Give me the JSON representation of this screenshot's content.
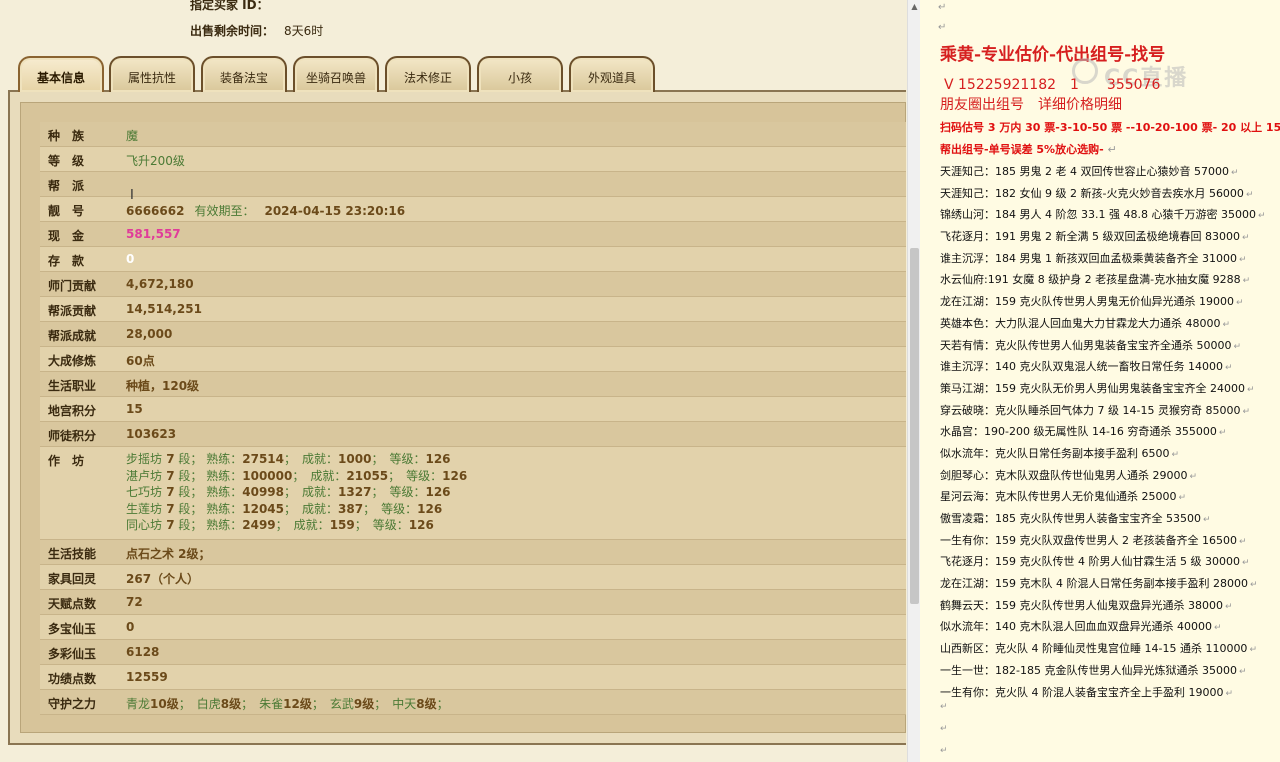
{
  "header": {
    "buyer_label": "指定买家 ID：",
    "time_label": "出售剩余时间：",
    "time_value": "8天6时"
  },
  "tabs": [
    "基本信息",
    "属性抗性",
    "装备法宝",
    "坐骑召唤兽",
    "法术修正",
    "小孩",
    "外观道具"
  ],
  "info": {
    "race": {
      "label": "种　族",
      "value": "魔"
    },
    "level": {
      "label": "等　级",
      "value": "飞升200级"
    },
    "faction": {
      "label": "帮　派",
      "value": ""
    },
    "id": {
      "label": "靓　号",
      "value": "6666662",
      "sub": "有效期至：",
      "expiry": "2024-04-15 23:20:16"
    },
    "cash": {
      "label": "现　金",
      "value": "581,557"
    },
    "deposit": {
      "label": "存　款",
      "value": "0"
    },
    "school_contrib": {
      "label": "师门贡献",
      "value": "4,672,180"
    },
    "faction_contrib": {
      "label": "帮派贡献",
      "value": "14,514,251"
    },
    "faction_achieve": {
      "label": "帮派成就",
      "value": "28,000"
    },
    "practice": {
      "label": "大成修炼",
      "value": "60点"
    },
    "life_job": {
      "label": "生活职业",
      "value": "种植，120级"
    },
    "palace_points": {
      "label": "地宫积分",
      "value": "15"
    },
    "mentor_points": {
      "label": "师徒积分",
      "value": "103623"
    },
    "workshop_label": "作　坊",
    "workshops": [
      {
        "name": "步摇坊",
        "rank": "7",
        "skill": "27514",
        "achieve": "1000",
        "level": "126"
      },
      {
        "name": "湛卢坊",
        "rank": "7",
        "skill": "100000",
        "achieve": "21055",
        "level": "126"
      },
      {
        "name": "七巧坊",
        "rank": "7",
        "skill": "40998",
        "achieve": "1327",
        "level": "126"
      },
      {
        "name": "生莲坊",
        "rank": "7",
        "skill": "12045",
        "achieve": "387",
        "level": "126"
      },
      {
        "name": "同心坊",
        "rank": "7",
        "skill": "2499",
        "achieve": "159",
        "level": "126"
      }
    ],
    "ws_words": {
      "rank_unit": "段；",
      "skill": "熟练：",
      "achieve": "成就：",
      "level": "等级："
    },
    "life_skill": {
      "label": "生活技能",
      "value": "点石之术 2级；"
    },
    "furniture": {
      "label": "家具回灵",
      "value": "267（个人）"
    },
    "talent": {
      "label": "天赋点数",
      "value": "72"
    },
    "duobao": {
      "label": "多宝仙玉",
      "value": "0"
    },
    "duocai": {
      "label": "多彩仙玉",
      "value": "6128"
    },
    "merit": {
      "label": "功绩点数",
      "value": "12559"
    },
    "guardian": {
      "label": "守护之力",
      "items": [
        {
          "name": "青龙",
          "lv": "10级"
        },
        {
          "name": "白虎",
          "lv": "8级"
        },
        {
          "name": "朱雀",
          "lv": "12级"
        },
        {
          "name": "玄武",
          "lv": "9级"
        },
        {
          "name": "中天",
          "lv": "8级"
        }
      ]
    }
  },
  "doc": {
    "title": "乘黄-专业估价-代出组号-找号",
    "phone": "V 15225921182　1　　355076",
    "moments": "朋友圈出组号　详细价格明细",
    "pricing": "扫码估号 3 万内 30 票-3-10-50 票 --10-20-100 票- 20 以上 150",
    "pricing2": "帮出组号-单号误差 5%放心选购-",
    "listings": [
      "天涯知己：185 男鬼 2 老 4 双回传世容止心猿妙音 57000",
      "天涯知己：182 女仙 9 级 2 新孩-火克火妙音去疾水月 56000",
      "锦绣山河：184 男人 4 阶忽 33.1 强 48.8 心猿千万游密 35000",
      "飞花逐月：191 男鬼 2 新全满 5 级双回孟极绝境春回 83000",
      "谁主沉浮：184 男鬼 1 新孩双回血孟极乘黄装备齐全 31000",
      "水云仙府:191 女魔 8 级护身 2 老孩星盘满-克水抽女魔 9288",
      "龙在江湖：159 克火队传世男人男鬼无价仙异光通杀 19000",
      "英雄本色：大力队混人回血鬼大力甘霖龙大力通杀 48000",
      "天若有情：克火队传世男人仙男鬼装备宝宝齐全通杀 50000",
      "谁主沉浮：140 克火队双鬼混人统一畜牧日常任务 14000",
      "策马江湖：159 克火队无价男人男仙男鬼装备宝宝齐全 24000",
      "穿云破晓：克火队睡杀回气体力 7 级 14-15 灵猴穷奇 85000",
      "水晶宫：190-200 级无属性队 14-16 穷奇通杀 355000",
      "似水流年：克火队日常任务副本接手盈利 6500",
      "剑胆琴心：克木队双盘队传世仙鬼男人通杀 29000",
      "星河云海：克木队传世男人无价鬼仙通杀 25000",
      "傲雪凌霜：185 克火队传世男人装备宝宝齐全 53500",
      "一生有你：159 克火队双盘传世男人 2 老孩装备齐全 16500",
      "飞花逐月：159 克火队传世 4 阶男人仙甘霖生活 5 级 30000",
      "龙在江湖：159 克木队 4 阶混人日常任务副本接手盈利 28000",
      "鹤舞云天：159 克火队传世男人仙鬼双盘异光通杀 38000",
      "似水流年：140 克木队混人回血血双盘异光通杀 40000",
      "山西新区：克火队 4 阶睡仙灵性鬼宫位睡 14-15 通杀 110000",
      "一生一世：182-185 克金队传世男人仙异光炼狱通杀 35000",
      "一生有你：克火队 4 阶混人装备宝宝齐全上手盈利 19000"
    ],
    "return_mark": "↵",
    "watermark": "CC直播"
  },
  "colors": {
    "accent_red": "#d61f1f",
    "value_brown": "#6b4a1a",
    "value_green": "#4b7a35",
    "cash_pink": "#e03c9a"
  }
}
